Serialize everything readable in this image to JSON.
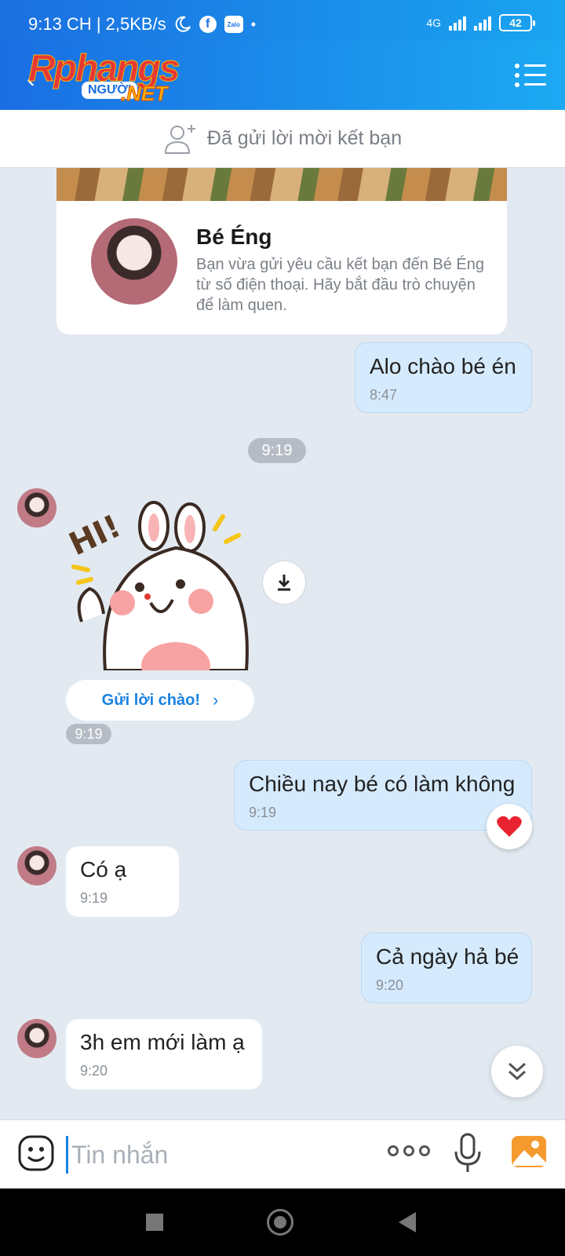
{
  "status_bar": {
    "time_and_speed": "9:13 CH | 2,5KB/s",
    "network_label": "4G",
    "battery": "42"
  },
  "header": {
    "logo_text": "Rphangs",
    "logo_badge": "NGƯỜI",
    "logo_suffix": ".NET"
  },
  "friend_banner": {
    "text": "Đã gửi lời mời kết bạn"
  },
  "profile": {
    "name": "Bé Éng",
    "description": "Bạn vừa gửi yêu cầu kết bạn đến Bé Éng từ số điện thoại. Hãy bắt đầu trò chuyện để làm quen."
  },
  "messages": [
    {
      "direction": "out",
      "text": "Alo chào bé én",
      "time": "8:47"
    },
    {
      "direction": "in",
      "type": "sticker",
      "time": "9:19"
    },
    {
      "direction": "out",
      "text": "Chiều nay bé có làm không",
      "time": "9:19",
      "reaction": "heart"
    },
    {
      "direction": "in",
      "text": "Có ạ",
      "time": "9:19"
    },
    {
      "direction": "out",
      "text": "Cả ngày hả bé",
      "time": "9:20"
    },
    {
      "direction": "in",
      "text": "3h em mới làm ạ",
      "time": "9:20"
    }
  ],
  "date_separator": "9:19",
  "sticker": {
    "text": "HI!",
    "greet_button_label": "Gửi lời chào!"
  },
  "input": {
    "placeholder": "Tin nhắn",
    "value": ""
  },
  "colors": {
    "header_start": "#1a6ee2",
    "header_end": "#1ca9f2",
    "outgoing_bubble": "#d5eafc",
    "incoming_bubble": "#ffffff",
    "chat_background": "#e2e9f1",
    "accent": "#1a82e2"
  },
  "icons": {
    "back": "back-arrow-icon",
    "menu": "list-menu-icon",
    "add_friend": "add-friend-icon",
    "download": "download-icon",
    "reaction": "heart-icon",
    "scroll": "double-chevron-down-icon",
    "emoji": "emoji-icon",
    "more": "more-icon",
    "mic": "microphone-icon",
    "image": "image-gallery-icon"
  }
}
